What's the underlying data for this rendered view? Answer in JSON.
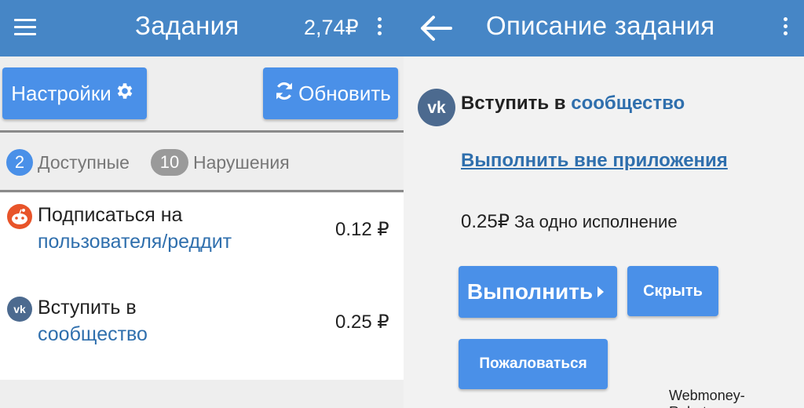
{
  "left": {
    "appbar": {
      "title": "Задания",
      "balance": "2,74₽"
    },
    "buttons": {
      "settings": "Настройки",
      "refresh": "Обновить"
    },
    "tabs": [
      {
        "count": "2",
        "label": "Доступные"
      },
      {
        "count": "10",
        "label": "Нарушения"
      }
    ],
    "tasks": [
      {
        "icon": "reddit-icon",
        "line1": "Подписаться на",
        "line2": "пользователя/реддит",
        "price": "0.12 ₽"
      },
      {
        "icon": "vk-icon",
        "line1": "Вступить в",
        "line2": "сообщество",
        "price": "0.25 ₽"
      }
    ]
  },
  "right": {
    "appbar": {
      "title": "Описание задания"
    },
    "task": {
      "title_prefix": "Вступить в",
      "title_link": "сообщество",
      "external_link": "Выполнить вне приложения",
      "reward_amount": "0.25₽",
      "reward_desc": "За одно исполнение"
    },
    "buttons": {
      "do": "Выполнить",
      "hide": "Скрыть",
      "report": "Пожаловаться"
    }
  },
  "watermark": "Webmoney-Rabota.ru",
  "colors": {
    "appbar": "#4686c6",
    "button": "#4a90e8",
    "link": "#2f6fad",
    "reddit": "#e8542a",
    "vk": "#4c6a8f"
  }
}
